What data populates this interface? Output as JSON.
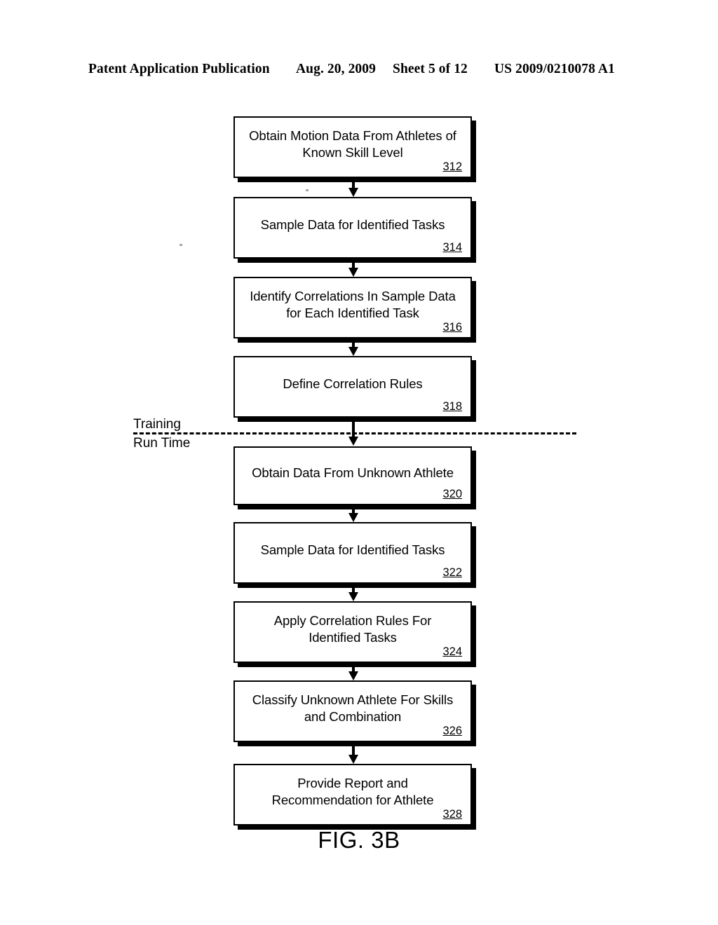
{
  "header": {
    "publication": "Patent Application Publication",
    "date": "Aug. 20, 2009",
    "sheet": "Sheet 5 of 12",
    "doc_number": "US 2009/0210078 A1"
  },
  "figure": {
    "caption": "FIG. 3B",
    "divider": {
      "above_label": "Training",
      "below_label": "Run Time"
    },
    "steps": [
      {
        "id": "312",
        "lines": [
          "Obtain Motion Data From Athletes of",
          "Known Skill Level"
        ],
        "ref": "312"
      },
      {
        "id": "314",
        "lines": [
          "Sample Data for Identified Tasks"
        ],
        "ref": "314"
      },
      {
        "id": "316",
        "lines": [
          "Identify Correlations In Sample Data",
          "for Each Identified Task"
        ],
        "ref": "316"
      },
      {
        "id": "318",
        "lines": [
          "Define Correlation Rules"
        ],
        "ref": "318"
      },
      {
        "id": "320",
        "lines": [
          "Obtain Data From Unknown Athlete"
        ],
        "ref": "320"
      },
      {
        "id": "322",
        "lines": [
          "Sample Data for Identified Tasks"
        ],
        "ref": "322"
      },
      {
        "id": "324",
        "lines": [
          "Apply Correlation Rules For",
          "Identified Tasks"
        ],
        "ref": "324"
      },
      {
        "id": "326",
        "lines": [
          "Classify Unknown Athlete For Skills",
          "and Combination"
        ],
        "ref": "326"
      },
      {
        "id": "328",
        "lines": [
          "Provide Report and",
          "Recommendation for Athlete"
        ],
        "ref": "328"
      }
    ]
  },
  "colors": {
    "ink": "#000000",
    "paper": "#ffffff"
  }
}
